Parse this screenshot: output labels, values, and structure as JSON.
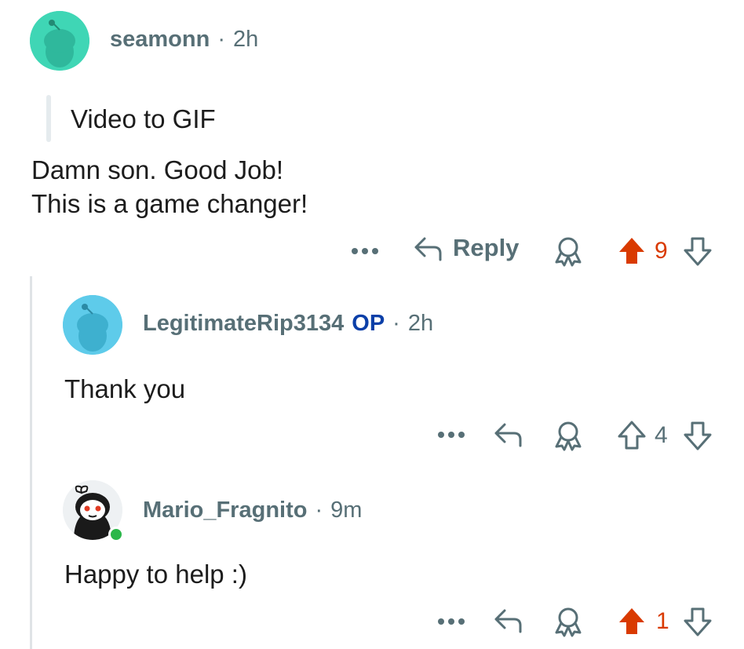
{
  "colors": {
    "upvoted": "#d93a00",
    "muted": "#576f76",
    "op_badge": "#0b3fa8",
    "avatar_teal": "#3fd6b5",
    "avatar_blue": "#5ecbea",
    "online": "#2bb74a"
  },
  "comments": [
    {
      "username": "seamonn",
      "dot": "·",
      "time": "2h",
      "quote": "Video to GIF",
      "body_lines": [
        "Damn son. Good Job!",
        "This is a game changer!"
      ],
      "actions": {
        "more": "more-icon",
        "reply_label": "Reply",
        "award": "award-icon",
        "score": "9",
        "vote_state": "upvoted"
      }
    },
    {
      "username": "LegitimateRip3134",
      "op_badge": "OP",
      "dot": "·",
      "time": "2h",
      "body_lines": [
        "Thank you"
      ],
      "actions": {
        "more": "more-icon",
        "award": "award-icon",
        "score": "4",
        "vote_state": "none"
      }
    },
    {
      "username": "Mario_Fragnito",
      "dot": "·",
      "time": "9m",
      "online": true,
      "body_lines": [
        "Happy to help :)"
      ],
      "actions": {
        "more": "more-icon",
        "award": "award-icon",
        "score": "1",
        "vote_state": "upvoted"
      }
    }
  ]
}
